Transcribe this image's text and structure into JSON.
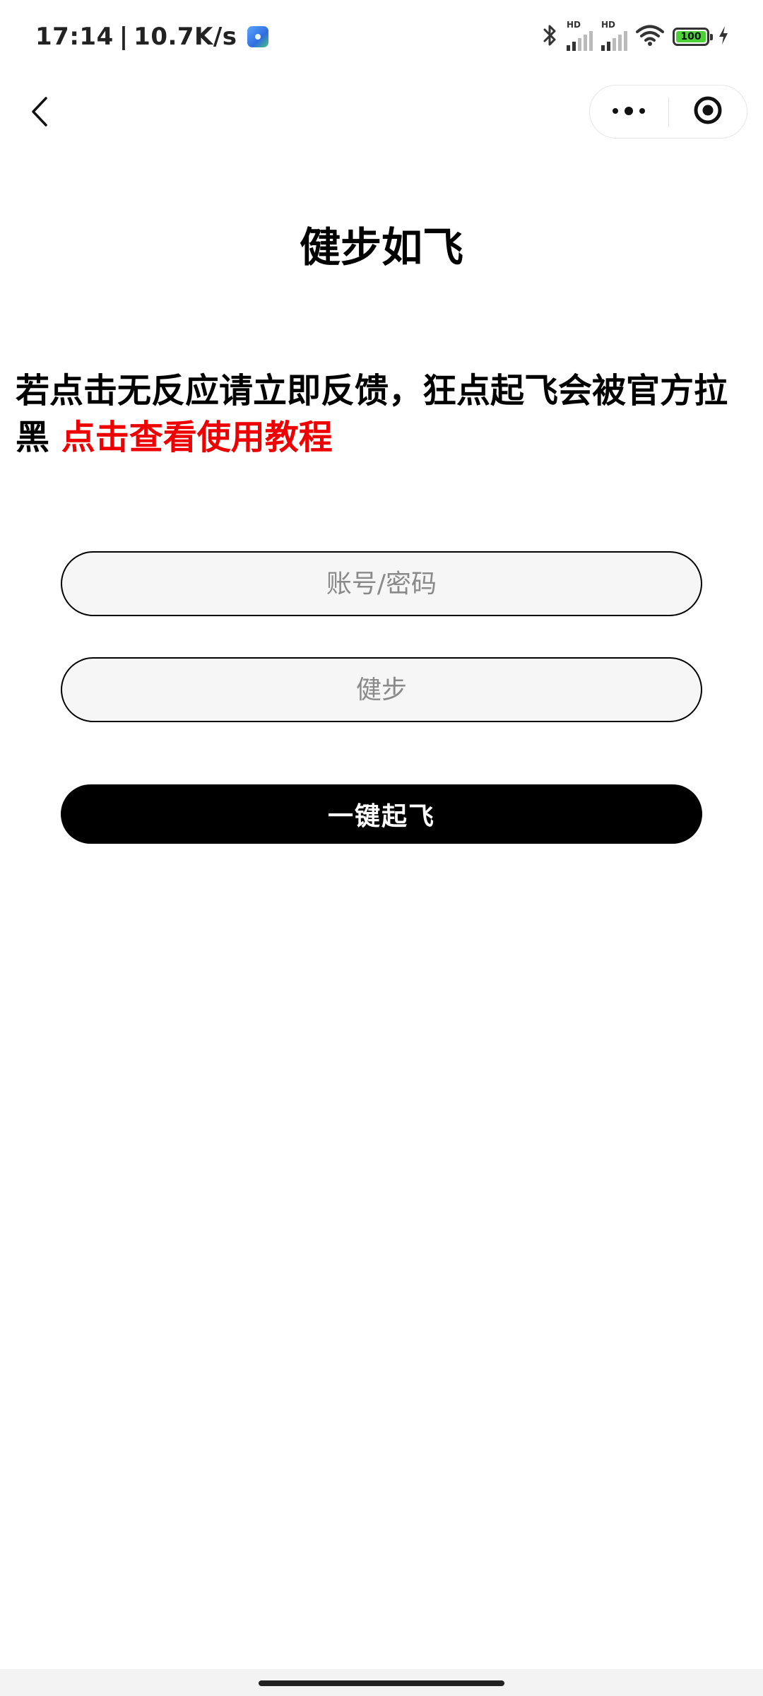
{
  "status_bar": {
    "time": "17:14",
    "separator": "|",
    "network_speed": "10.7K/s",
    "battery_level": "100",
    "signal_label_1": "HD",
    "signal_label_2": "HD",
    "icons": [
      "app-notification-icon",
      "bluetooth-icon",
      "signal-icon",
      "wifi-icon",
      "battery-icon",
      "charging-icon"
    ]
  },
  "nav": {
    "icons": [
      "back-arrow-icon",
      "more-dots-icon",
      "close-target-icon"
    ]
  },
  "page": {
    "title": "健步如飞",
    "notice_text": "若点击无反应请立即反馈，狂点起飞会被官方拉黑 ",
    "notice_link": "点击查看使用教程"
  },
  "form": {
    "account_placeholder": "账号/密码",
    "account_value": "",
    "steps_placeholder": "健步",
    "steps_value": "",
    "submit_label": "一键起飞"
  },
  "colors": {
    "link_red": "#ee0000",
    "button_black": "#000000",
    "input_bg": "#f7f6f6",
    "battery_green": "#4cd137"
  }
}
